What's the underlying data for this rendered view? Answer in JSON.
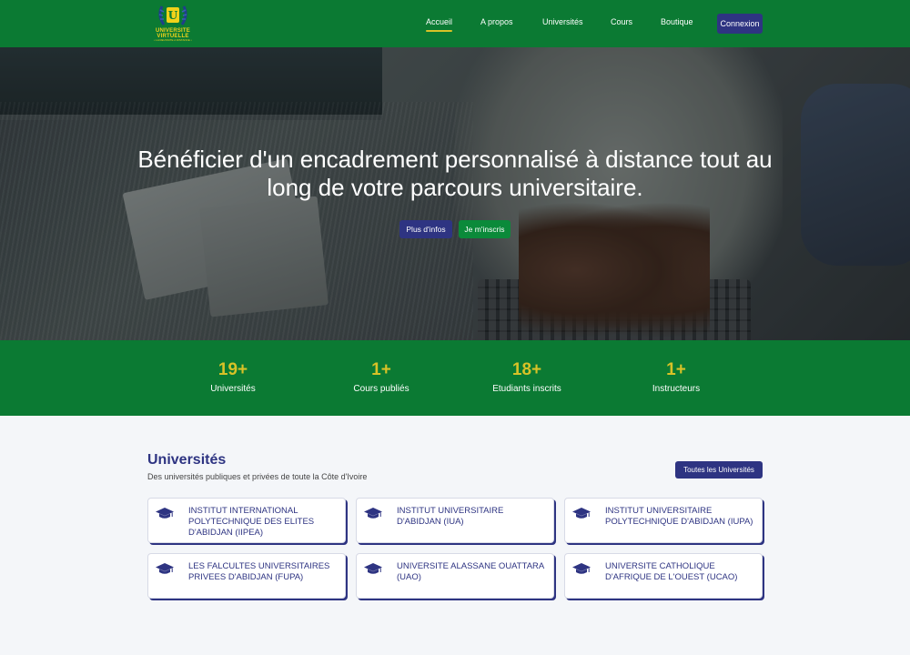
{
  "brand": {
    "logo_line1": "UNIVERSITE",
    "logo_line2": "VIRTUELLE",
    "logo_tagline": "• LA REUSSITE A DISTANCE •",
    "accent_green": "#0b7a33",
    "accent_blue": "#2e3482",
    "accent_gold": "#d8c227"
  },
  "nav": {
    "items": [
      {
        "label": "Accueil",
        "active": true
      },
      {
        "label": "A propos",
        "active": false
      },
      {
        "label": "Universités",
        "active": false
      },
      {
        "label": "Cours",
        "active": false
      },
      {
        "label": "Boutique",
        "active": false
      }
    ],
    "login_label": "Connexion"
  },
  "hero": {
    "title": "Bénéficier d'un encadrement personnalisé à distance tout au long de votre parcours universitaire.",
    "btn_info": "Plus d'infos",
    "btn_signup": "Je m'inscris"
  },
  "stats": [
    {
      "value": "19+",
      "label": "Universités"
    },
    {
      "value": "1+",
      "label": "Cours publiés"
    },
    {
      "value": "18+",
      "label": "Etudiants inscrits"
    },
    {
      "value": "1+",
      "label": "Instructeurs"
    }
  ],
  "universities": {
    "title": "Universités",
    "subtitle": "Des universités publiques et privées de toute la Côte d'Ivoire",
    "all_button": "Toutes les Universités",
    "icon": "graduation-cap-icon",
    "items": [
      {
        "name": "INSTITUT INTERNATIONAL POLYTECHNIQUE DES ELITES D'ABIDJAN (IIPEA)"
      },
      {
        "name": "INSTITUT UNIVERSITAIRE D'ABIDJAN (IUA)"
      },
      {
        "name": "INSTITUT UNIVERSITAIRE POLYTECHNIQUE D'ABIDJAN (IUPA)"
      },
      {
        "name": "LES FALCULTES UNIVERSITAIRES PRIVEES D'ABIDJAN (FUPA)"
      },
      {
        "name": "UNIVERSITE ALASSANE OUATTARA (UAO)"
      },
      {
        "name": "UNIVERSITE CATHOLIQUE D'AFRIQUE DE L'OUEST (UCAO)"
      }
    ]
  }
}
